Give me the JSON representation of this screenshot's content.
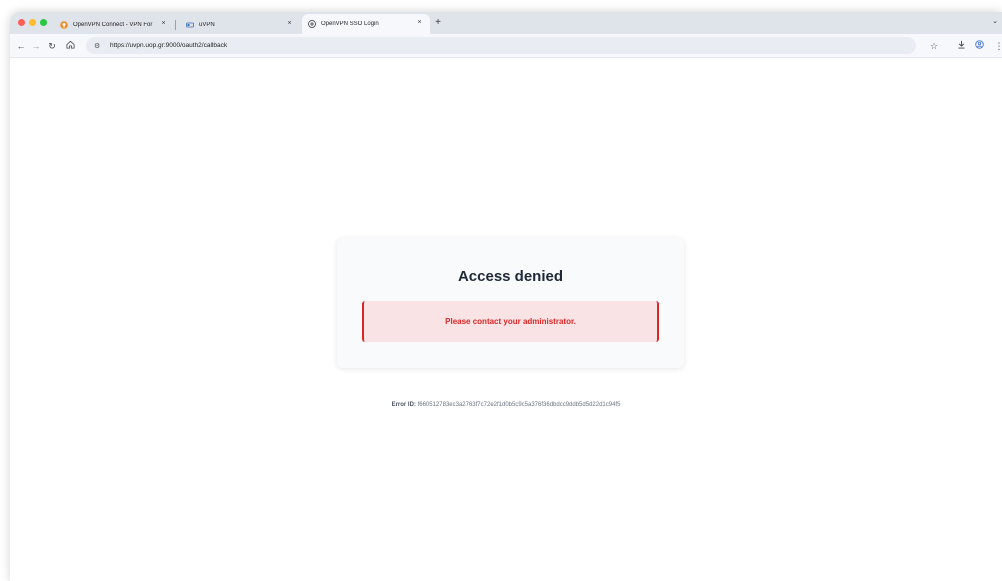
{
  "browser": {
    "tabs": [
      {
        "title": "OpenVPN Connect - VPN For",
        "close": "×"
      },
      {
        "title": "uVPN",
        "close": "×"
      },
      {
        "title": "OpenVPN SSO Login",
        "close": "×"
      }
    ],
    "new_tab": "+",
    "url": "https://uvpn.uop.gr:9000/oauth2/callback"
  },
  "page": {
    "title": "Access denied",
    "alert": "Please contact your administrator.",
    "error_label": "Error ID:",
    "error_id": "f660512783ec3a2763f7c72e2f1d0b5c9c5a376f36dbdcc9ddb5d5d22d1c94f5"
  },
  "colors": {
    "alert_text": "#dc2626",
    "alert_bg": "#f9e3e4",
    "title": "#1f2937"
  },
  "icons": [
    "back-icon",
    "forward-icon",
    "reload-icon",
    "home-icon",
    "site-settings-icon",
    "bookmark-star-icon",
    "download-icon",
    "profile-icon",
    "menu-icon"
  ]
}
